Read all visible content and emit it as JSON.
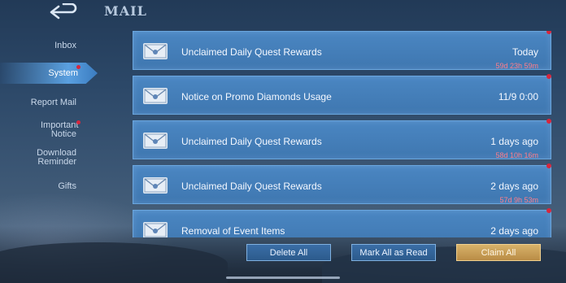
{
  "header": {
    "title": "MAIL",
    "back_icon": "back-arrow-icon"
  },
  "sidebar": {
    "items": [
      {
        "label": "Inbox",
        "selected": false,
        "badge": false
      },
      {
        "label": "System",
        "selected": true,
        "badge": true
      },
      {
        "label": "Report Mail",
        "selected": false,
        "badge": false
      },
      {
        "label": "Important Notice",
        "selected": false,
        "badge": true
      },
      {
        "label": "Download Reminder",
        "selected": false,
        "badge": false
      },
      {
        "label": "Gifts",
        "selected": false,
        "badge": false
      }
    ]
  },
  "mails": [
    {
      "subject": "Unclaimed Daily Quest Rewards",
      "date": "Today",
      "timer": "59d 23h 59m",
      "unread": true,
      "icon": "envelope-icon"
    },
    {
      "subject": "Notice on Promo Diamonds Usage",
      "date": "11/9 0:00",
      "timer": "",
      "unread": true,
      "icon": "envelope-icon"
    },
    {
      "subject": "Unclaimed Daily Quest Rewards",
      "date": "1 days ago",
      "timer": "58d 10h 16m",
      "unread": true,
      "icon": "envelope-icon"
    },
    {
      "subject": "Unclaimed Daily Quest Rewards",
      "date": "2 days ago",
      "timer": "57d 9h 53m",
      "unread": true,
      "icon": "envelope-icon"
    },
    {
      "subject": "Removal of Event Items",
      "date": "2 days ago",
      "timer": "",
      "unread": true,
      "icon": "envelope-icon"
    }
  ],
  "actions": {
    "delete_all": "Delete All",
    "mark_all_read": "Mark All as Read",
    "claim_all": "Claim All"
  },
  "colors": {
    "accent_blue": "#4a86c2",
    "badge_red": "#d7263d",
    "timer_red": "#ff7d8a",
    "claim_gold": "#d8b26a"
  }
}
